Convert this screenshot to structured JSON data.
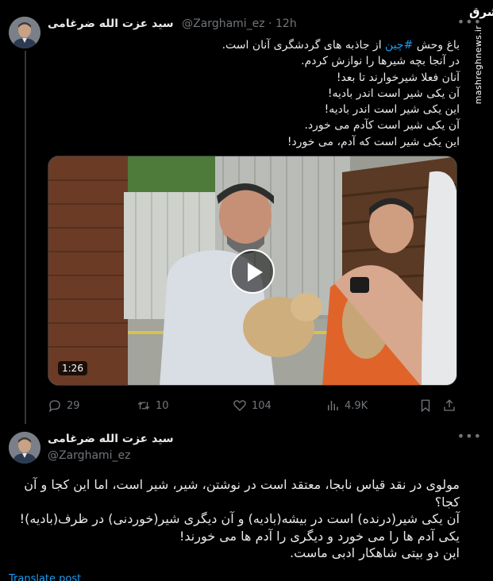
{
  "tweet1": {
    "author_name": "سید عزت الله ضرغامی",
    "handle": "@Zarghami_ez",
    "separator": "·",
    "time": "12h",
    "text_lines": [
      {
        "before": "باغ وحش ",
        "hashtag": "#چین",
        "after": " از جاذبه های گردشگری آنان است."
      },
      {
        "before": "در آنجا بچه شیرها را نوازش کردم.",
        "hashtag": "",
        "after": ""
      },
      {
        "before": "آنان فعلا شیرخوارند تا بعد!",
        "hashtag": "",
        "after": ""
      },
      {
        "before": "آن یکی شیر است اندر بادیه!",
        "hashtag": "",
        "after": ""
      },
      {
        "before": "این یکی شیر است اندر بادیه!",
        "hashtag": "",
        "after": ""
      },
      {
        "before": "آن یکی شیر است کآدم می خورد.",
        "hashtag": "",
        "after": ""
      },
      {
        "before": "این یکی شیر است که آدم، می خورد!",
        "hashtag": "",
        "after": ""
      }
    ],
    "media": {
      "duration": "1:26",
      "play_icon": "play-icon"
    },
    "actions": {
      "replies": "29",
      "reposts": "10",
      "likes": "104",
      "views": "4.9K"
    }
  },
  "tweet2": {
    "author_name": "سید عزت الله ضرغامی",
    "handle": "@Zarghami_ez",
    "text_lines": [
      "مولوی در نقد قیاس نابجا، معتقد است در نوشتن، شیر، شیر است، اما این کجا و آن",
      "کجا؟",
      "آن یکی شیر(درنده) است در بیشه(بادیه) و آن دیگری شیر(خوردنی) در ظرف(بادیه)!",
      "یکی آدم ها را می خورد و دیگری را آدم ها می خورند!",
      "این دو بیتی شاهکار ادبی ماست."
    ],
    "translate_label": "Translate post"
  },
  "watermark": {
    "logo": "مشرق",
    "site": "mashreghnews.ir"
  },
  "colors": {
    "background": "#000000",
    "text": "#e7e9ea",
    "muted": "#71767b",
    "link": "#1d9bf0"
  }
}
